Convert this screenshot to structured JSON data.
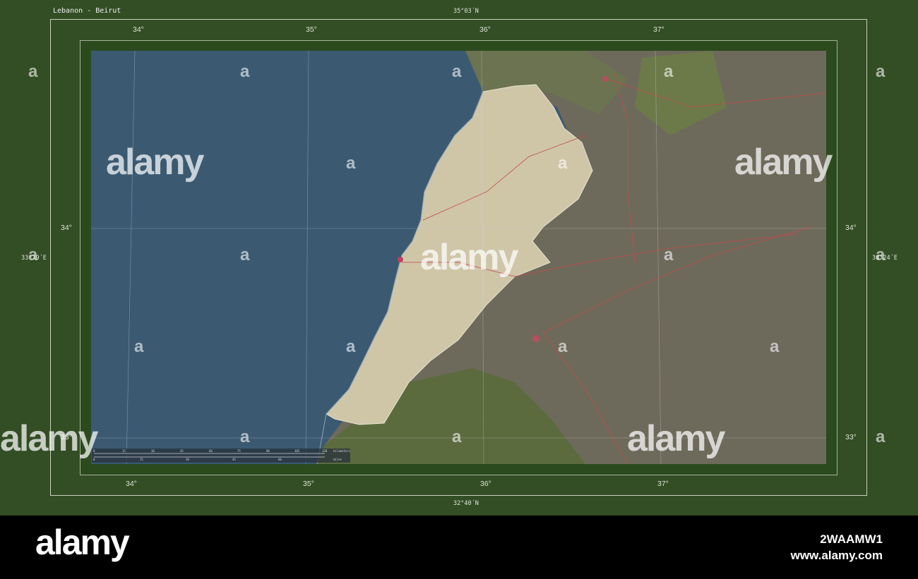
{
  "map": {
    "title": "Lebanon - Beirut",
    "lat_top": "35°03´N",
    "lat_bottom": "32°40´N",
    "lon_left": "33°19´E",
    "lon_right": "38°24´E",
    "lon_ticks_top": [
      "34°",
      "35°",
      "36°",
      "37°"
    ],
    "lon_ticks_bottom": [
      "34°",
      "35°",
      "36°",
      "37°"
    ],
    "lat_ticks_left": [
      "34°",
      "33°"
    ],
    "lat_ticks_right": [
      "34°",
      "33°"
    ],
    "scale": {
      "km_labels": [
        "0",
        "15",
        "30",
        "45",
        "60",
        "75",
        "90",
        "105",
        "120"
      ],
      "km_unit": "kilometers",
      "mi_labels": [
        "0",
        "15",
        "30",
        "45",
        "60"
      ],
      "mi_unit": "miles"
    },
    "colors": {
      "sea": "#3b5a72",
      "highlight_country": "#cfc6a8",
      "neighbor_land": "#6f6a5c",
      "frame": "#334d24"
    }
  },
  "watermark": {
    "word": "alamy",
    "letter": "a"
  },
  "footer": {
    "logo": "alamy",
    "image_id": "2WAAMW1",
    "url": "www.alamy.com"
  }
}
